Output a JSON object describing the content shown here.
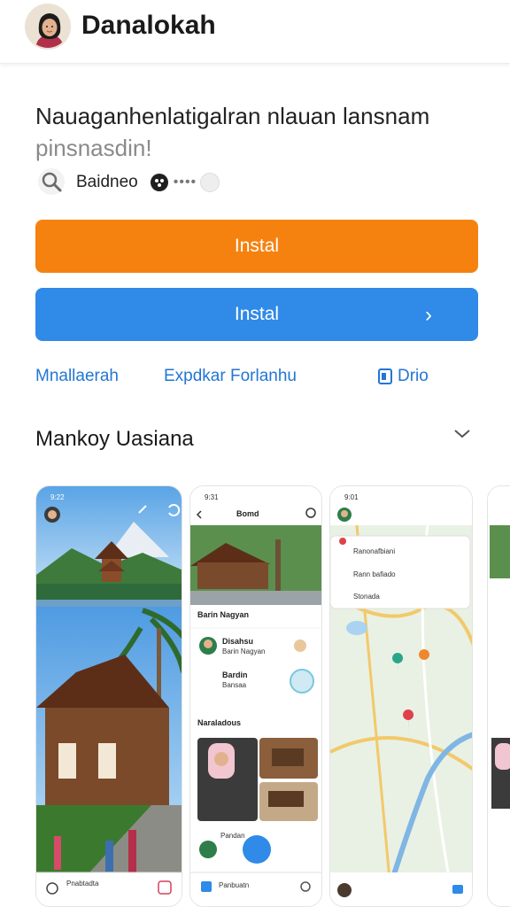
{
  "header": {
    "title": "Danalokah"
  },
  "description": {
    "line1": "Nauaganhenlatigalran  nlauan lansnam",
    "line2": "pinsnasdin!"
  },
  "meta": {
    "publisher": "Baidneo",
    "dots": "••••"
  },
  "buttons": {
    "primary_install": "Instal",
    "secondary_install": "Instal"
  },
  "links": {
    "link1": "Mnallaerah",
    "link2": "Expdkar Forlanhu",
    "link3": "Drio"
  },
  "section": {
    "title": "Mankoy Uasiana"
  },
  "screenshots": {
    "s1": {
      "time": "9:22",
      "bottom_label": "Pnabtadta"
    },
    "s2": {
      "time": "9:31",
      "title": "Bomd",
      "section1": "Barin Nagyan",
      "user1": "Disahsu",
      "user1_sub": "Barin Nagyan",
      "user2": "Bardin",
      "user2_sub": "Bansaa",
      "section2": "Naraladous",
      "list_item": "Pandan",
      "bottom_label": "Panbuatn"
    },
    "s3": {
      "time": "9:01",
      "row1": "Ranonafbiani",
      "row2": "Rann bafiado",
      "row3": "Stonada"
    }
  },
  "colors": {
    "orange": "#f5820f",
    "blue": "#2f8ae8",
    "link": "#2376d3"
  }
}
